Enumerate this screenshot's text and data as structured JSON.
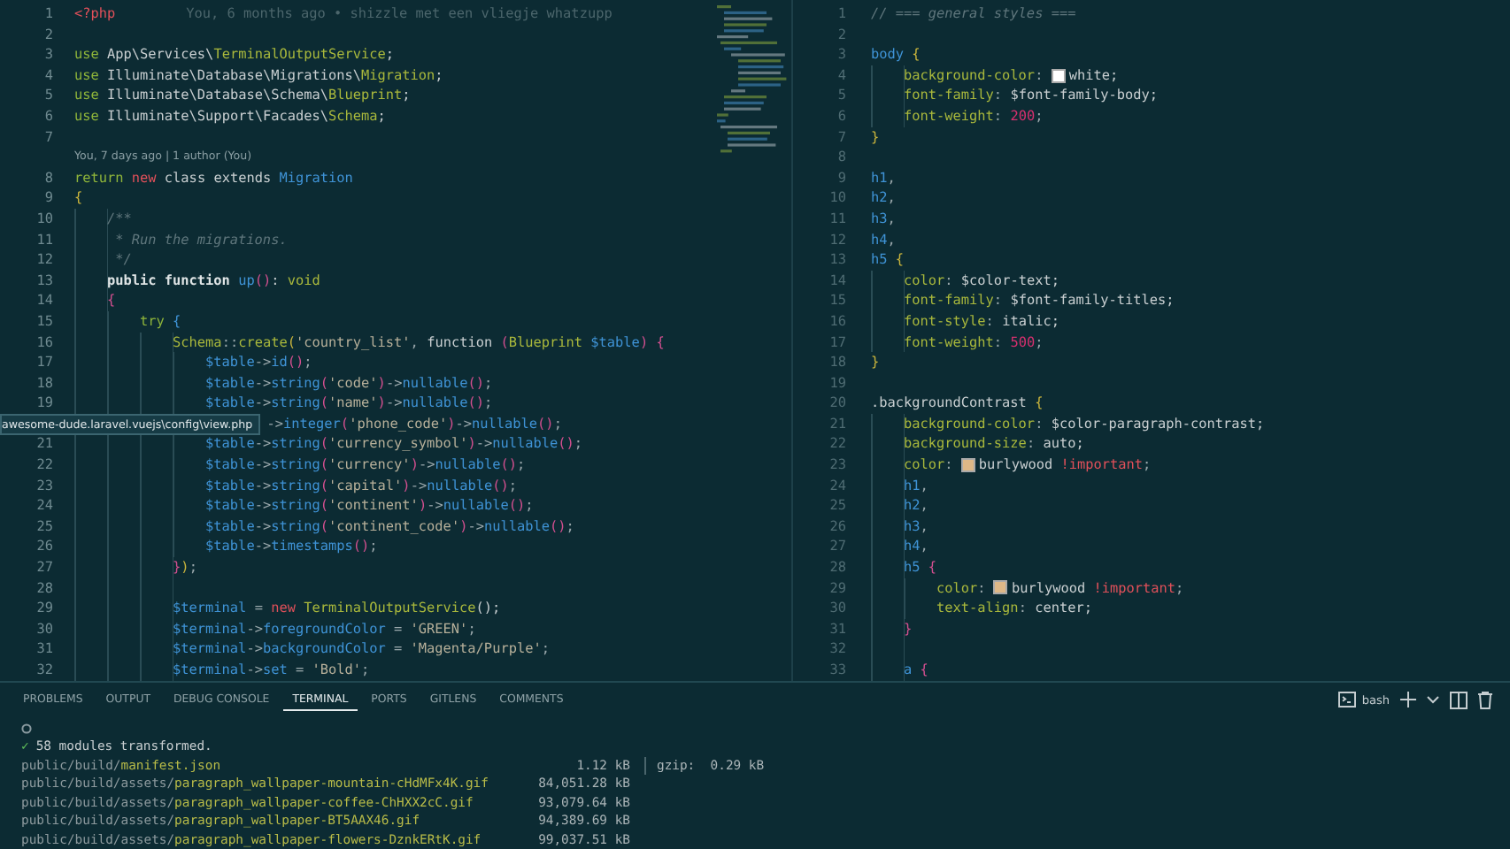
{
  "editor_left": {
    "tooltip": "awesome-dude.laravel.vuejs\\config\\view.php",
    "lines": [
      {
        "kind": "code",
        "number": "1",
        "tokens": [
          {
            "kind": "red",
            "text": "<?php"
          }
        ],
        "blame": "You, 6 months ago • shizzle met een vliegje whatzupp"
      },
      {
        "kind": "code",
        "number": "2"
      },
      {
        "kind": "code",
        "number": "3",
        "tokens": [
          {
            "kind": "kw",
            "text": "use"
          },
          {
            "kind": "plain",
            "text": " App\\Services\\"
          },
          {
            "kind": "type",
            "text": "TerminalOutputService"
          },
          {
            "kind": "plain",
            "text": ";"
          }
        ]
      },
      {
        "kind": "code",
        "number": "4",
        "tokens": [
          {
            "kind": "kw",
            "text": "use"
          },
          {
            "kind": "plain",
            "text": " Illuminate\\Database\\Migrations\\"
          },
          {
            "kind": "type",
            "text": "Migration"
          },
          {
            "kind": "plain",
            "text": ";"
          }
        ]
      },
      {
        "kind": "code",
        "number": "5",
        "tokens": [
          {
            "kind": "kw",
            "text": "use"
          },
          {
            "kind": "plain",
            "text": " Illuminate\\Database\\Schema\\"
          },
          {
            "kind": "type",
            "text": "Blueprint"
          },
          {
            "kind": "plain",
            "text": ";"
          }
        ]
      },
      {
        "kind": "code",
        "number": "6",
        "tokens": [
          {
            "kind": "kw",
            "text": "use"
          },
          {
            "kind": "plain",
            "text": " Illuminate\\Support\\Facades\\"
          },
          {
            "kind": "type",
            "text": "Schema"
          },
          {
            "kind": "plain",
            "text": ";"
          }
        ]
      },
      {
        "kind": "code",
        "number": "7"
      },
      {
        "kind": "codelens",
        "text": "You, 7 days ago | 1 author (You)"
      },
      {
        "kind": "code",
        "number": "8",
        "tokens": [
          {
            "kind": "kw",
            "text": "return "
          },
          {
            "kind": "red",
            "text": "new"
          },
          {
            "kind": "plain",
            "text": " class extends "
          },
          {
            "kind": "fn",
            "text": "Migration"
          }
        ]
      },
      {
        "kind": "code",
        "number": "9",
        "tokens": [
          {
            "kind": "b1",
            "text": "{"
          }
        ],
        "children": [
          {
            "kind": "code",
            "number": "10",
            "tokens": [
              {
                "kind": "cmt",
                "text": "/**"
              }
            ]
          },
          {
            "kind": "code",
            "number": "11",
            "tokens": [
              {
                "kind": "cmt",
                "text": " * Run the migrations."
              }
            ]
          },
          {
            "kind": "code",
            "number": "12",
            "tokens": [
              {
                "kind": "cmt",
                "text": " */"
              }
            ]
          },
          {
            "kind": "code",
            "number": "13",
            "tokens": [
              {
                "kind": "bold",
                "text": "public function "
              },
              {
                "kind": "fn",
                "text": "up"
              },
              {
                "kind": "b2",
                "text": "()"
              },
              {
                "kind": "plain",
                "text": ": "
              },
              {
                "kind": "type",
                "text": "void"
              }
            ]
          },
          {
            "kind": "code",
            "number": "14",
            "tokens": [
              {
                "kind": "b2",
                "text": "{"
              }
            ],
            "children": [
              {
                "kind": "code",
                "number": "15",
                "tokens": [
                  {
                    "kind": "kw",
                    "text": "try "
                  },
                  {
                    "kind": "b3",
                    "text": "{"
                  }
                ],
                "children": [
                  {
                    "kind": "code",
                    "number": "16",
                    "tokens": [
                      {
                        "kind": "type",
                        "text": "Schema"
                      },
                      {
                        "kind": "op",
                        "text": "::"
                      },
                      {
                        "kind": "type",
                        "text": "create"
                      },
                      {
                        "kind": "b1",
                        "text": "("
                      },
                      {
                        "kind": "str",
                        "text": "'country_list'"
                      },
                      {
                        "kind": "op",
                        "text": ", "
                      },
                      {
                        "kind": "plain",
                        "text": "function "
                      },
                      {
                        "kind": "b2",
                        "text": "("
                      },
                      {
                        "kind": "type",
                        "text": "Blueprint "
                      },
                      {
                        "kind": "fn",
                        "text": "$table"
                      },
                      {
                        "kind": "b2",
                        "text": ") {"
                      }
                    ],
                    "children": [
                      {
                        "kind": "code",
                        "number": "17",
                        "tokens": [
                          {
                            "kind": "fn",
                            "text": "$table"
                          },
                          {
                            "kind": "op",
                            "text": "->"
                          },
                          {
                            "kind": "fn",
                            "text": "id"
                          },
                          {
                            "kind": "b2",
                            "text": "()"
                          },
                          {
                            "kind": "op",
                            "text": ";"
                          }
                        ]
                      },
                      {
                        "kind": "code",
                        "number": "18",
                        "tokens": [
                          {
                            "kind": "fn",
                            "text": "$table"
                          },
                          {
                            "kind": "op",
                            "text": "->"
                          },
                          {
                            "kind": "fn",
                            "text": "string"
                          },
                          {
                            "kind": "b2",
                            "text": "("
                          },
                          {
                            "kind": "str",
                            "text": "'code'"
                          },
                          {
                            "kind": "b2",
                            "text": ")"
                          },
                          {
                            "kind": "op",
                            "text": "->"
                          },
                          {
                            "kind": "fn",
                            "text": "nullable"
                          },
                          {
                            "kind": "b2",
                            "text": "()"
                          },
                          {
                            "kind": "op",
                            "text": ";"
                          }
                        ]
                      },
                      {
                        "kind": "code",
                        "number": "19",
                        "tokens": [
                          {
                            "kind": "fn",
                            "text": "$table"
                          },
                          {
                            "kind": "op",
                            "text": "->"
                          },
                          {
                            "kind": "fn",
                            "text": "string"
                          },
                          {
                            "kind": "b2",
                            "text": "("
                          },
                          {
                            "kind": "str",
                            "text": "'name'"
                          },
                          {
                            "kind": "b2",
                            "text": ")"
                          },
                          {
                            "kind": "op",
                            "text": "->"
                          },
                          {
                            "kind": "fn",
                            "text": "nullable"
                          },
                          {
                            "kind": "b2",
                            "text": "()"
                          },
                          {
                            "kind": "op",
                            "text": ";"
                          }
                        ]
                      },
                      {
                        "kind": "partial",
                        "tokens": [
                          {
                            "kind": "op",
                            "text": "->"
                          },
                          {
                            "kind": "fn",
                            "text": "integer"
                          },
                          {
                            "kind": "b2",
                            "text": "("
                          },
                          {
                            "kind": "str",
                            "text": "'phone_code'"
                          },
                          {
                            "kind": "b2",
                            "text": ")"
                          },
                          {
                            "kind": "op",
                            "text": "->"
                          },
                          {
                            "kind": "fn",
                            "text": "nullable"
                          },
                          {
                            "kind": "b2",
                            "text": "()"
                          },
                          {
                            "kind": "op",
                            "text": ";"
                          }
                        ]
                      },
                      {
                        "kind": "code",
                        "number": "21",
                        "tokens": [
                          {
                            "kind": "fn",
                            "text": "$table"
                          },
                          {
                            "kind": "op",
                            "text": "->"
                          },
                          {
                            "kind": "fn",
                            "text": "string"
                          },
                          {
                            "kind": "b2",
                            "text": "("
                          },
                          {
                            "kind": "str",
                            "text": "'currency_symbol'"
                          },
                          {
                            "kind": "b2",
                            "text": ")"
                          },
                          {
                            "kind": "op",
                            "text": "->"
                          },
                          {
                            "kind": "fn",
                            "text": "nullable"
                          },
                          {
                            "kind": "b2",
                            "text": "()"
                          },
                          {
                            "kind": "op",
                            "text": ";"
                          }
                        ]
                      },
                      {
                        "kind": "code",
                        "number": "22",
                        "tokens": [
                          {
                            "kind": "fn",
                            "text": "$table"
                          },
                          {
                            "kind": "op",
                            "text": "->"
                          },
                          {
                            "kind": "fn",
                            "text": "string"
                          },
                          {
                            "kind": "b2",
                            "text": "("
                          },
                          {
                            "kind": "str",
                            "text": "'currency'"
                          },
                          {
                            "kind": "b2",
                            "text": ")"
                          },
                          {
                            "kind": "op",
                            "text": "->"
                          },
                          {
                            "kind": "fn",
                            "text": "nullable"
                          },
                          {
                            "kind": "b2",
                            "text": "()"
                          },
                          {
                            "kind": "op",
                            "text": ";"
                          }
                        ]
                      },
                      {
                        "kind": "code",
                        "number": "23",
                        "tokens": [
                          {
                            "kind": "fn",
                            "text": "$table"
                          },
                          {
                            "kind": "op",
                            "text": "->"
                          },
                          {
                            "kind": "fn",
                            "text": "string"
                          },
                          {
                            "kind": "b2",
                            "text": "("
                          },
                          {
                            "kind": "str",
                            "text": "'capital'"
                          },
                          {
                            "kind": "b2",
                            "text": ")"
                          },
                          {
                            "kind": "op",
                            "text": "->"
                          },
                          {
                            "kind": "fn",
                            "text": "nullable"
                          },
                          {
                            "kind": "b2",
                            "text": "()"
                          },
                          {
                            "kind": "op",
                            "text": ";"
                          }
                        ]
                      },
                      {
                        "kind": "code",
                        "number": "24",
                        "tokens": [
                          {
                            "kind": "fn",
                            "text": "$table"
                          },
                          {
                            "kind": "op",
                            "text": "->"
                          },
                          {
                            "kind": "fn",
                            "text": "string"
                          },
                          {
                            "kind": "b2",
                            "text": "("
                          },
                          {
                            "kind": "str",
                            "text": "'continent'"
                          },
                          {
                            "kind": "b2",
                            "text": ")"
                          },
                          {
                            "kind": "op",
                            "text": "->"
                          },
                          {
                            "kind": "fn",
                            "text": "nullable"
                          },
                          {
                            "kind": "b2",
                            "text": "()"
                          },
                          {
                            "kind": "op",
                            "text": ";"
                          }
                        ]
                      },
                      {
                        "kind": "code",
                        "number": "25",
                        "tokens": [
                          {
                            "kind": "fn",
                            "text": "$table"
                          },
                          {
                            "kind": "op",
                            "text": "->"
                          },
                          {
                            "kind": "fn",
                            "text": "string"
                          },
                          {
                            "kind": "b2",
                            "text": "("
                          },
                          {
                            "kind": "str",
                            "text": "'continent_code'"
                          },
                          {
                            "kind": "b2",
                            "text": ")"
                          },
                          {
                            "kind": "op",
                            "text": "->"
                          },
                          {
                            "kind": "fn",
                            "text": "nullable"
                          },
                          {
                            "kind": "b2",
                            "text": "()"
                          },
                          {
                            "kind": "op",
                            "text": ";"
                          }
                        ]
                      },
                      {
                        "kind": "code",
                        "number": "26",
                        "tokens": [
                          {
                            "kind": "fn",
                            "text": "$table"
                          },
                          {
                            "kind": "op",
                            "text": "->"
                          },
                          {
                            "kind": "fn",
                            "text": "timestamps"
                          },
                          {
                            "kind": "b2",
                            "text": "()"
                          },
                          {
                            "kind": "op",
                            "text": ";"
                          }
                        ]
                      }
                    ]
                  },
                  {
                    "kind": "code",
                    "number": "27",
                    "tokens": [
                      {
                        "kind": "b2",
                        "text": "}"
                      },
                      {
                        "kind": "b1",
                        "text": ")"
                      },
                      {
                        "kind": "op",
                        "text": ";"
                      }
                    ]
                  },
                  {
                    "kind": "code",
                    "number": "28"
                  },
                  {
                    "kind": "code",
                    "number": "29",
                    "tokens": [
                      {
                        "kind": "fn",
                        "text": "$terminal"
                      },
                      {
                        "kind": "op",
                        "text": " = "
                      },
                      {
                        "kind": "red",
                        "text": "new "
                      },
                      {
                        "kind": "type",
                        "text": "TerminalOutputService"
                      },
                      {
                        "kind": "plain",
                        "text": "();"
                      }
                    ]
                  },
                  {
                    "kind": "code",
                    "number": "30",
                    "tokens": [
                      {
                        "kind": "fn",
                        "text": "$terminal"
                      },
                      {
                        "kind": "op",
                        "text": "->"
                      },
                      {
                        "kind": "fn",
                        "text": "foregroundColor"
                      },
                      {
                        "kind": "op",
                        "text": " = "
                      },
                      {
                        "kind": "str",
                        "text": "'GREEN'"
                      },
                      {
                        "kind": "op",
                        "text": ";"
                      }
                    ]
                  },
                  {
                    "kind": "code",
                    "number": "31",
                    "tokens": [
                      {
                        "kind": "fn",
                        "text": "$terminal"
                      },
                      {
                        "kind": "op",
                        "text": "->"
                      },
                      {
                        "kind": "fn",
                        "text": "backgroundColor"
                      },
                      {
                        "kind": "op",
                        "text": " = "
                      },
                      {
                        "kind": "str",
                        "text": "'Magenta/Purple'"
                      },
                      {
                        "kind": "op",
                        "text": ";"
                      }
                    ]
                  },
                  {
                    "kind": "code",
                    "number": "32",
                    "tokens": [
                      {
                        "kind": "fn",
                        "text": "$terminal"
                      },
                      {
                        "kind": "op",
                        "text": "->"
                      },
                      {
                        "kind": "fn",
                        "text": "set"
                      },
                      {
                        "kind": "op",
                        "text": " = "
                      },
                      {
                        "kind": "str",
                        "text": "'Bold'"
                      },
                      {
                        "kind": "op",
                        "text": ";"
                      }
                    ]
                  }
                ]
              }
            ]
          }
        ]
      }
    ]
  },
  "editor_right": {
    "lines": [
      {
        "kind": "code",
        "number": "1",
        "tokens": [
          {
            "kind": "cmt",
            "text": "// === general styles ==="
          }
        ]
      },
      {
        "kind": "code",
        "number": "2"
      },
      {
        "kind": "code",
        "number": "3",
        "tokens": [
          {
            "kind": "fn",
            "text": "body"
          },
          {
            "kind": "b1",
            "text": " {"
          }
        ],
        "children": [
          {
            "kind": "code",
            "number": "4",
            "tokens": [
              {
                "kind": "type",
                "text": "background-color"
              },
              {
                "kind": "op",
                "text": ": "
              },
              {
                "kind": "swatch",
                "color": "#ffffff"
              },
              {
                "kind": "plain",
                "text": "white;"
              }
            ]
          },
          {
            "kind": "code",
            "number": "5",
            "tokens": [
              {
                "kind": "type",
                "text": "font-family"
              },
              {
                "kind": "op",
                "text": ": "
              },
              {
                "kind": "plain",
                "text": "$font-family-body;"
              }
            ]
          },
          {
            "kind": "code",
            "number": "6",
            "tokens": [
              {
                "kind": "type",
                "text": "font-weight"
              },
              {
                "kind": "op",
                "text": ": "
              },
              {
                "kind": "num",
                "text": "200"
              },
              {
                "kind": "op",
                "text": ";"
              }
            ]
          }
        ]
      },
      {
        "kind": "code",
        "number": "7",
        "tokens": [
          {
            "kind": "b1",
            "text": "}"
          }
        ]
      },
      {
        "kind": "code",
        "number": "8"
      },
      {
        "kind": "code",
        "number": "9",
        "tokens": [
          {
            "kind": "fn",
            "text": "h1"
          },
          {
            "kind": "op",
            "text": ","
          }
        ]
      },
      {
        "kind": "code",
        "number": "10",
        "tokens": [
          {
            "kind": "fn",
            "text": "h2"
          },
          {
            "kind": "op",
            "text": ","
          }
        ]
      },
      {
        "kind": "code",
        "number": "11",
        "tokens": [
          {
            "kind": "fn",
            "text": "h3"
          },
          {
            "kind": "op",
            "text": ","
          }
        ]
      },
      {
        "kind": "code",
        "number": "12",
        "tokens": [
          {
            "kind": "fn",
            "text": "h4"
          },
          {
            "kind": "op",
            "text": ","
          }
        ]
      },
      {
        "kind": "code",
        "number": "13",
        "tokens": [
          {
            "kind": "fn",
            "text": "h5"
          },
          {
            "kind": "b1",
            "text": " {"
          }
        ],
        "children": [
          {
            "kind": "code",
            "number": "14",
            "tokens": [
              {
                "kind": "type",
                "text": "color"
              },
              {
                "kind": "op",
                "text": ": "
              },
              {
                "kind": "plain",
                "text": "$color-text;"
              }
            ]
          },
          {
            "kind": "code",
            "number": "15",
            "tokens": [
              {
                "kind": "type",
                "text": "font-family"
              },
              {
                "kind": "op",
                "text": ": "
              },
              {
                "kind": "plain",
                "text": "$font-family-titles;"
              }
            ]
          },
          {
            "kind": "code",
            "number": "16",
            "tokens": [
              {
                "kind": "type",
                "text": "font-style"
              },
              {
                "kind": "op",
                "text": ": "
              },
              {
                "kind": "plain",
                "text": "italic;"
              }
            ]
          },
          {
            "kind": "code",
            "number": "17",
            "tokens": [
              {
                "kind": "type",
                "text": "font-weight"
              },
              {
                "kind": "op",
                "text": ": "
              },
              {
                "kind": "num",
                "text": "500"
              },
              {
                "kind": "op",
                "text": ";"
              }
            ]
          }
        ]
      },
      {
        "kind": "code",
        "number": "18",
        "tokens": [
          {
            "kind": "b1",
            "text": "}"
          }
        ]
      },
      {
        "kind": "code",
        "number": "19"
      },
      {
        "kind": "code",
        "number": "20",
        "tokens": [
          {
            "kind": "plain",
            "text": ".backgroundContrast"
          },
          {
            "kind": "b1",
            "text": " {"
          }
        ],
        "children": [
          {
            "kind": "code",
            "number": "21",
            "tokens": [
              {
                "kind": "type",
                "text": "background-color"
              },
              {
                "kind": "op",
                "text": ": "
              },
              {
                "kind": "plain",
                "text": "$color-paragraph-contrast;"
              }
            ]
          },
          {
            "kind": "code",
            "number": "22",
            "tokens": [
              {
                "kind": "type",
                "text": "background-size"
              },
              {
                "kind": "op",
                "text": ": "
              },
              {
                "kind": "plain",
                "text": "auto;"
              }
            ]
          },
          {
            "kind": "code",
            "number": "23",
            "tokens": [
              {
                "kind": "type",
                "text": "color"
              },
              {
                "kind": "op",
                "text": ": "
              },
              {
                "kind": "swatch",
                "color": "#deb887"
              },
              {
                "kind": "plain",
                "text": "burlywood "
              },
              {
                "kind": "red",
                "text": "!important"
              },
              {
                "kind": "op",
                "text": ";"
              }
            ]
          },
          {
            "kind": "code",
            "number": "24",
            "tokens": [
              {
                "kind": "fn",
                "text": "h1"
              },
              {
                "kind": "op",
                "text": ","
              }
            ]
          },
          {
            "kind": "code",
            "number": "25",
            "tokens": [
              {
                "kind": "fn",
                "text": "h2"
              },
              {
                "kind": "op",
                "text": ","
              }
            ]
          },
          {
            "kind": "code",
            "number": "26",
            "tokens": [
              {
                "kind": "fn",
                "text": "h3"
              },
              {
                "kind": "op",
                "text": ","
              }
            ]
          },
          {
            "kind": "code",
            "number": "27",
            "tokens": [
              {
                "kind": "fn",
                "text": "h4"
              },
              {
                "kind": "op",
                "text": ","
              }
            ]
          },
          {
            "kind": "code",
            "number": "28",
            "tokens": [
              {
                "kind": "fn",
                "text": "h5"
              },
              {
                "kind": "b2",
                "text": " {"
              }
            ],
            "children": [
              {
                "kind": "code",
                "number": "29",
                "tokens": [
                  {
                    "kind": "type",
                    "text": "color"
                  },
                  {
                    "kind": "op",
                    "text": ": "
                  },
                  {
                    "kind": "swatch",
                    "color": "#deb887"
                  },
                  {
                    "kind": "plain",
                    "text": "burlywood "
                  },
                  {
                    "kind": "red",
                    "text": "!important"
                  },
                  {
                    "kind": "op",
                    "text": ";"
                  }
                ]
              },
              {
                "kind": "code",
                "number": "30",
                "tokens": [
                  {
                    "kind": "type",
                    "text": "text-align"
                  },
                  {
                    "kind": "op",
                    "text": ": "
                  },
                  {
                    "kind": "plain",
                    "text": "center;"
                  }
                ]
              }
            ]
          },
          {
            "kind": "code",
            "number": "31",
            "tokens": [
              {
                "kind": "b2",
                "text": "}"
              }
            ]
          },
          {
            "kind": "code",
            "number": "32"
          },
          {
            "kind": "code",
            "number": "33",
            "tokens": [
              {
                "kind": "fn",
                "text": "a"
              },
              {
                "kind": "b2",
                "text": " {"
              }
            ]
          }
        ]
      }
    ]
  },
  "panel": {
    "tabs": [
      {
        "label": "PROBLEMS",
        "selected": false
      },
      {
        "label": "OUTPUT",
        "selected": false
      },
      {
        "label": "DEBUG CONSOLE",
        "selected": false
      },
      {
        "label": "TERMINAL",
        "selected": true
      },
      {
        "label": "PORTS",
        "selected": false
      },
      {
        "label": "GITLENS",
        "selected": false
      },
      {
        "label": "COMMENTS",
        "selected": false
      }
    ],
    "shell": "bash",
    "terminal": {
      "check": "✓",
      "message": "58 modules transformed.",
      "rows": [
        {
          "dir": "public/build/",
          "file": "manifest.json",
          "size": "1.12 kB",
          "gzip": "gzip:  0.29 kB"
        },
        {
          "dir": "public/build/assets/",
          "file": "paragraph_wallpaper-mountain-cHdMFx4K.gif",
          "size": "84,051.28 kB"
        },
        {
          "dir": "public/build/assets/",
          "file": "paragraph_wallpaper-coffee-ChHXX2cC.gif",
          "size": "93,079.64 kB"
        },
        {
          "dir": "public/build/assets/",
          "file": "paragraph_wallpaper-BT5AAX46.gif",
          "size": "94,389.69 kB"
        },
        {
          "dir": "public/build/assets/",
          "file": "paragraph_wallpaper-flowers-DznkERtK.gif",
          "size": "99,037.51 kB"
        }
      ]
    }
  }
}
